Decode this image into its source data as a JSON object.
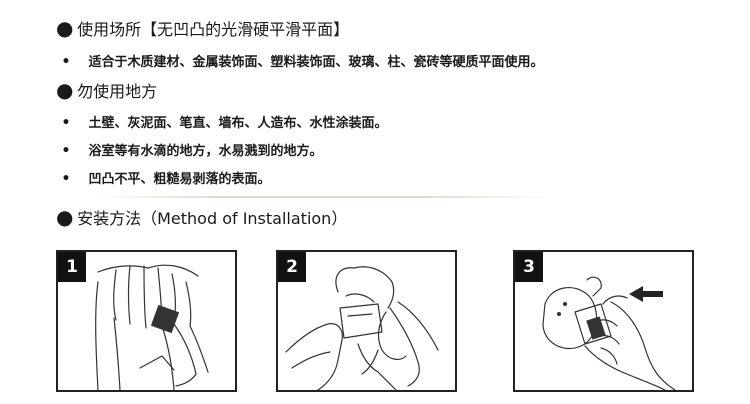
{
  "sections": {
    "usage": {
      "title": "使用场所【无凹凸的光滑硬平滑平面】",
      "items": [
        "适合于木质建材、金属装饰面、塑料装饰面、玻璃、柱、瓷砖等硬质平面使用。"
      ]
    },
    "avoid": {
      "title": "勿使用地方",
      "items": [
        "土壁、灰泥面、笔直、墙布、人造布、水性涂装面。",
        "浴室等有水滴的地方，水易溅到的地方。",
        "凹凸不平、粗糙易剥落的表面。"
      ]
    },
    "install": {
      "title": "安装方法（Method  of  Installation）"
    }
  },
  "bullets": {
    "large": "●",
    "small": "•"
  },
  "steps": [
    {
      "number": "1",
      "illustration": "hands-wiping-surface"
    },
    {
      "number": "2",
      "illustration": "hands-peeling-backing"
    },
    {
      "number": "3",
      "illustration": "hand-pressing-hook-to-wall"
    }
  ]
}
